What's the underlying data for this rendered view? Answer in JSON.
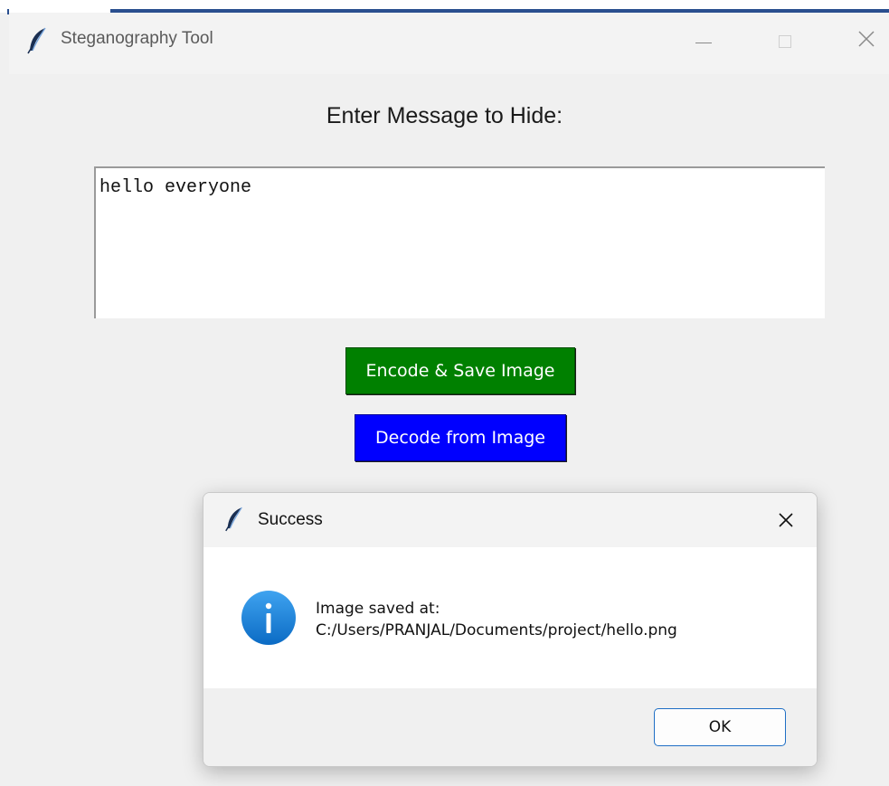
{
  "window": {
    "title": "Steganography Tool",
    "icon": "feather-icon"
  },
  "main": {
    "prompt_label": "Enter Message to Hide:",
    "message_value": "hello everyone",
    "encode_button": {
      "label": "Encode & Save Image",
      "color": "#008000"
    },
    "decode_button": {
      "label": "Decode from Image",
      "color": "#0000ff"
    }
  },
  "dialog": {
    "title": "Success",
    "icon": "info-icon",
    "message_line1": "Image saved at:",
    "message_line2": "C:/Users/PRANJAL/Documents/project/hello.png",
    "ok_label": "OK",
    "accent_color": "#1f6fc5"
  }
}
